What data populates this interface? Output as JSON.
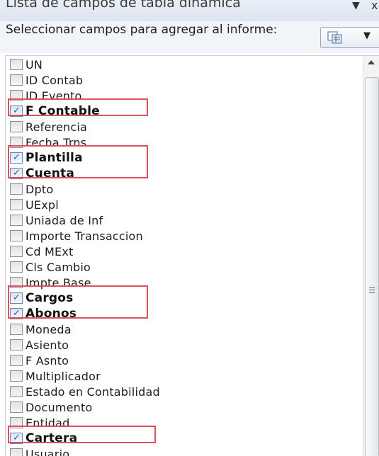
{
  "panel": {
    "title": "Lista de campos de tabla dinámica",
    "title_arrow": "▼",
    "close_glyph": "x",
    "subheader_label": "Seleccionar campos para agregar al informe:",
    "layout_arrow": "▼"
  },
  "fields": [
    {
      "label": "UN",
      "checked": false
    },
    {
      "label": "ID Contab",
      "checked": false
    },
    {
      "label": "ID Evento",
      "checked": false
    },
    {
      "label": "F Contable",
      "checked": true
    },
    {
      "label": "Referencia",
      "checked": false
    },
    {
      "label": "Fecha Trns",
      "checked": false
    },
    {
      "label": "Plantilla",
      "checked": true
    },
    {
      "label": "Cuenta",
      "checked": true
    },
    {
      "label": "Dpto",
      "checked": false
    },
    {
      "label": "UExpl",
      "checked": false
    },
    {
      "label": "Uniada de Inf",
      "checked": false
    },
    {
      "label": "Importe Transaccion",
      "checked": false
    },
    {
      "label": "Cd MExt",
      "checked": false
    },
    {
      "label": "Cls Cambio",
      "checked": false
    },
    {
      "label": "Impte Base",
      "checked": false
    },
    {
      "label": "Cargos",
      "checked": true
    },
    {
      "label": "Abonos",
      "checked": true
    },
    {
      "label": "Moneda",
      "checked": false
    },
    {
      "label": "Asiento",
      "checked": false
    },
    {
      "label": "F Asnto",
      "checked": false
    },
    {
      "label": "Multiplicador",
      "checked": false
    },
    {
      "label": "Estado en Contabilidad",
      "checked": false
    },
    {
      "label": "Documento",
      "checked": false
    },
    {
      "label": "Entidad",
      "checked": false
    },
    {
      "label": "Cartera",
      "checked": true
    },
    {
      "label": "Usuario",
      "checked": false
    }
  ],
  "colors": {
    "highlight": "#e04f5f",
    "check": "#3d5a8c"
  },
  "icons": {
    "layout": "field-list-layout-icon",
    "scroll_up": "scroll-up-arrow-icon",
    "grip": "scroll-grip-icon",
    "check": "checkmark-icon"
  }
}
